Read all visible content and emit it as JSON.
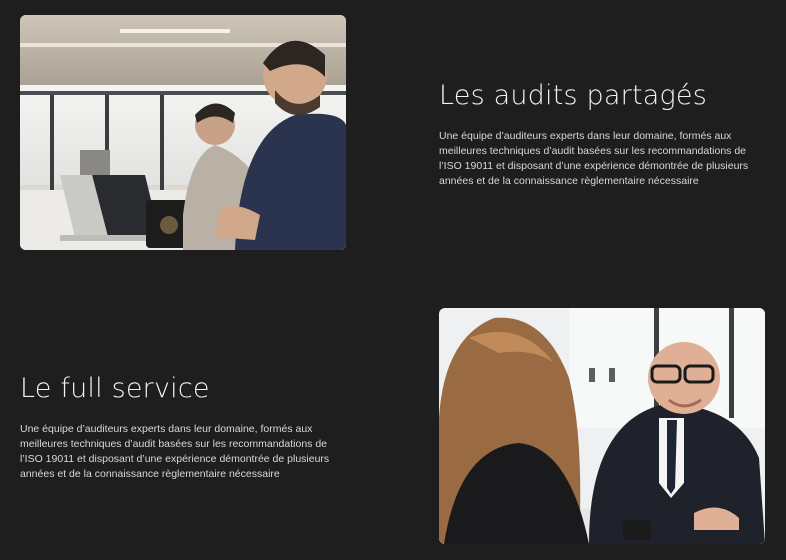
{
  "sections": [
    {
      "title": "Les audits partagés",
      "description_lines": [
        "Une équipe d’auditeurs experts dans leur domaine, formés   aux",
        "meilleures techniques d’audit basées sur les recommandations de",
        "l’ISO 19011 et disposant   d’une expérience démontrée de plusieurs",
        "années et de la connaissance règlementaire nécessaire"
      ]
    },
    {
      "title": "Le full service",
      "description_lines": [
        "Une équipe d’auditeurs experts dans leur domaine, formés   aux",
        "meilleures techniques d’audit basées sur les recommandations de",
        "l’ISO 19011 et disposant   d’une expérience démontrée de plusieurs",
        "années et de la connaissance règlementaire nécessaire"
      ]
    }
  ],
  "colors": {
    "background": "#1e1e1e",
    "heading": "#f2f2f2",
    "body_text": "#d8d8d8"
  }
}
